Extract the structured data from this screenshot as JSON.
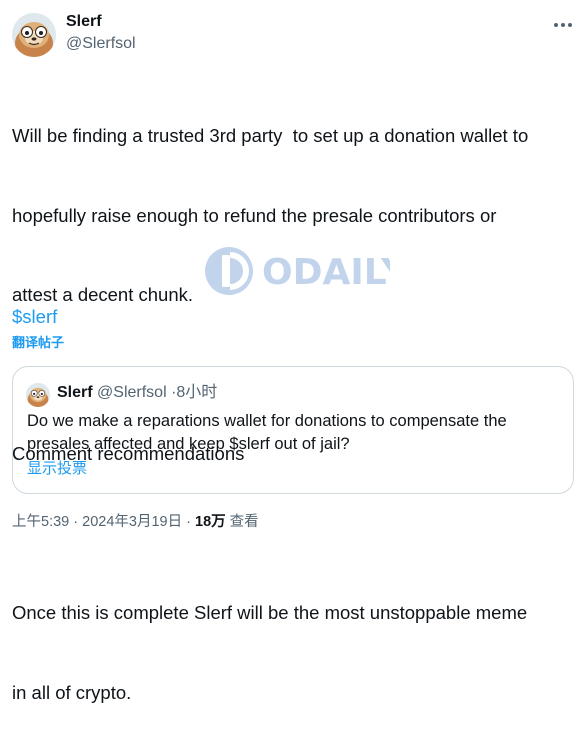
{
  "author": {
    "name": "Slerf",
    "handle": "@Slerfsol"
  },
  "more_icon": "three-dots-icon",
  "tweet": {
    "lines": [
      "Will be finding a trusted 3rd party  to set up a donation wallet to",
      "hopefully raise enough to refund the presale contributors or",
      "attest a decent chunk.",
      "",
      "Comment recommendations",
      "",
      "Once this is complete Slerf will be the most unstoppable meme",
      "in all of crypto."
    ],
    "cashtag": "$slerf",
    "translate_label": "翻译帖子"
  },
  "watermark": {
    "text": "ODAILY"
  },
  "quote": {
    "name": "Slerf",
    "handle": "@Slerfsol",
    "separator": "·",
    "time": "8小时",
    "text": "Do we make a reparations wallet for donations to compensate the presales affected and keep $slerf out of jail?",
    "poll_label": "显示投票"
  },
  "footer": {
    "time": "上午5:39",
    "separator": "·",
    "date": "2024年3月19日",
    "views_count": "18万",
    "views_label": "查看"
  },
  "colors": {
    "link": "#1d9bf0",
    "muted": "#536471",
    "text": "#0f1419",
    "border": "#cfd9de"
  }
}
